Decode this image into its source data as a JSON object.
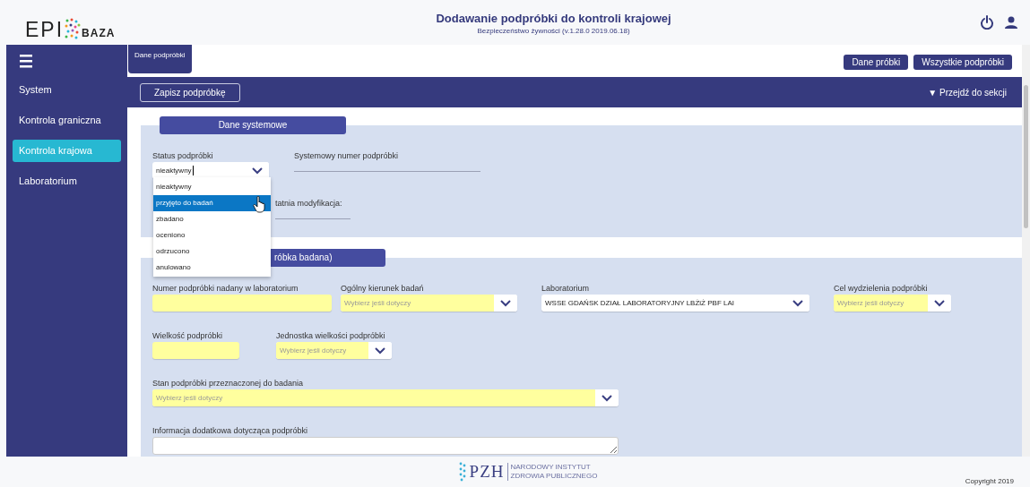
{
  "header": {
    "logo_mark": "EPI",
    "logo_name": "BAZA",
    "title": "Dodawanie podpróbki do kontroli krajowej",
    "subtitle": "Bezpieczeństwo żywności (v.1.28.0 2019.06.18)"
  },
  "sidebar": {
    "items": [
      {
        "label": "System",
        "selected": false
      },
      {
        "label": "Kontrola graniczna",
        "selected": false
      },
      {
        "label": "Kontrola krajowa",
        "selected": true
      },
      {
        "label": "Laboratorium",
        "selected": false
      }
    ]
  },
  "tabs": [
    {
      "label": "Dane podpróbki",
      "selected": true
    }
  ],
  "top_buttons": [
    "Dane próbki",
    "Wszystkie podpróbki"
  ],
  "toolbar": {
    "save_button": "Zapisz podpróbkę",
    "jump_link": "▼ Przejdź do sekcji"
  },
  "sections": [
    {
      "title": "Dane systemowe",
      "rows": [
        {
          "fields": [
            {
              "kind": "select",
              "label": "Status podpróbki",
              "value": "nieaktywny",
              "highlighted": false,
              "expanded": true
            },
            {
              "kind": "readonly",
              "label": "Systemowy numer podpróbki"
            }
          ]
        },
        {
          "fields": [
            {
              "kind": "readonly",
              "label": "tatnia modyfikacja:"
            }
          ]
        }
      ]
    },
    {
      "title": "róbka badana)",
      "rows": [
        {
          "fields": [
            {
              "kind": "text",
              "label": "Numer podpróbki nadany w laboratorium",
              "highlighted": true
            },
            {
              "kind": "select",
              "label": "Ogólny kierunek badań",
              "placeholder": "Wybierz jeśli dotyczy",
              "highlighted": true,
              "expanded": false
            },
            {
              "kind": "select",
              "label": "Laboratorium",
              "value": "WSSE GDAŃSK DZIAŁ LABORATORYJNY LBŻiŻ PBF LAI",
              "highlighted": false,
              "expanded": false
            },
            {
              "kind": "select",
              "label": "Cel wydzielenia podpróbki",
              "placeholder": "Wybierz jeśli dotyczy",
              "highlighted": true,
              "expanded": false
            }
          ]
        },
        {
          "fields": [
            {
              "kind": "text",
              "label": "Wielkość podpróbki",
              "highlighted": true
            },
            {
              "kind": "select",
              "label": "Jednostka wielkości podpróbki",
              "placeholder": "Wybierz jeśli dotyczy",
              "highlighted": true,
              "expanded": false
            }
          ]
        },
        {
          "fields": [
            {
              "kind": "select",
              "label": "Stan podpróbki przeznaczonej do badania",
              "placeholder": "Wybierz jeśli dotyczy",
              "highlighted": true,
              "expanded": false
            }
          ]
        },
        {
          "fields": [
            {
              "kind": "textarea",
              "label": "Informacja dodatkowa dotycząca podpróbki"
            }
          ]
        }
      ]
    }
  ],
  "status_dropdown": {
    "options": [
      {
        "label": "nieaktywny",
        "selected": false
      },
      {
        "label": "przyjęto do badań",
        "selected": true
      },
      {
        "label": "zbadano",
        "selected": false
      },
      {
        "label": "oceniono",
        "selected": false
      },
      {
        "label": "odrzucono",
        "selected": false
      },
      {
        "label": "anulowano",
        "selected": false
      }
    ]
  },
  "footer": {
    "logo_text": "PZH",
    "institute_lines": [
      "NARODOWY INSTYTUT",
      "ZDROWIA PUBLICZNEGO"
    ],
    "copyright": "Copyright 2019"
  }
}
